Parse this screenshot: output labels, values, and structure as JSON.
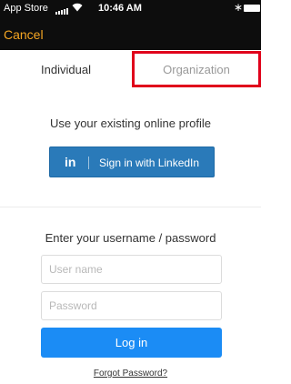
{
  "status_bar": {
    "carrier": "App Store",
    "time": "10:46 AM",
    "bluetooth_glyph": "∗"
  },
  "nav": {
    "cancel_label": "Cancel"
  },
  "tabs": [
    {
      "label": "Individual",
      "selected": true
    },
    {
      "label": "Organization",
      "selected": false
    }
  ],
  "online_profile": {
    "prompt": "Use your existing online profile",
    "linkedin_logo": "in",
    "linkedin_label": "Sign in with LinkedIn"
  },
  "credentials": {
    "prompt": "Enter your username / password",
    "username_placeholder": "User name",
    "password_placeholder": "Password",
    "login_label": "Log in",
    "forgot_label": "Forgot Password?"
  },
  "colors": {
    "header_bg": "#0d0d0d",
    "cancel": "#f5a623",
    "linkedin": "#2a7ab9",
    "login": "#1b8cf5",
    "highlight": "#e0001b"
  }
}
